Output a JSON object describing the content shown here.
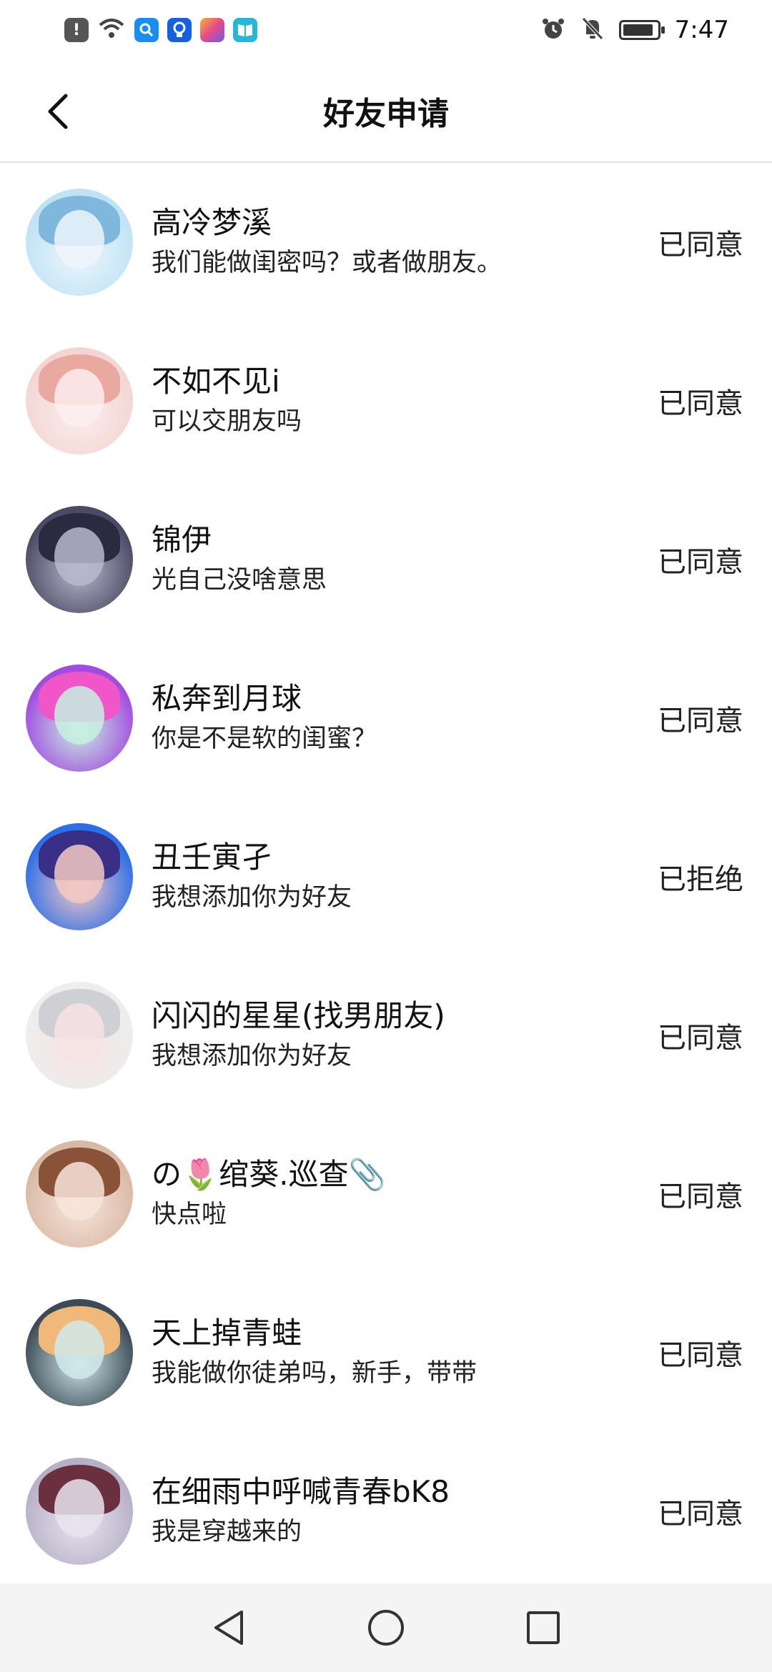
{
  "status_bar": {
    "time": "7:47",
    "battery_level": 0.9,
    "notification_icons": [
      "alert-icon",
      "wifi-icon",
      "search-app-icon",
      "bulb-app-icon",
      "colorful-app-icon",
      "book-app-icon"
    ],
    "right_icons": [
      "alarm-icon",
      "mute-icon",
      "battery-icon"
    ]
  },
  "header": {
    "title": "好友申请"
  },
  "requests": [
    {
      "name": "高冷梦溪",
      "message": "我们能做闺密吗？或者做朋友。",
      "status": "已同意",
      "avatar_colors": [
        "#bfe3f5",
        "#7fb7dd",
        "#eef6fb"
      ]
    },
    {
      "name": "不如不见i",
      "message": "可以交朋友吗",
      "status": "已同意",
      "avatar_colors": [
        "#f3d6d2",
        "#e9a9a0",
        "#fbeeee"
      ]
    },
    {
      "name": "锦伊",
      "message": "光自己没啥意思",
      "status": "已同意",
      "avatar_colors": [
        "#4b4a66",
        "#2b2a40",
        "#b9b7cc"
      ]
    },
    {
      "name": "私奔到月球",
      "message": "你是不是软的闺蜜？",
      "status": "已同意",
      "avatar_colors": [
        "#a24be0",
        "#f056c8",
        "#c7f1e0"
      ]
    },
    {
      "name": "丑壬寅孑",
      "message": "我想添加你为好友",
      "status": "已拒绝",
      "avatar_colors": [
        "#2b6ee8",
        "#3a2f86",
        "#f5c9c3"
      ]
    },
    {
      "name": "闪闪的星星(找男朋友)",
      "message": "我想添加你为好友",
      "status": "已同意",
      "avatar_colors": [
        "#eeeeee",
        "#cfcfd6",
        "#f6e3e3"
      ]
    },
    {
      "name": "の🌷绾葵.巡查📎",
      "message": "快点啦",
      "status": "已同意",
      "avatar_colors": [
        "#d9b8a4",
        "#8a5236",
        "#f7e5dc"
      ]
    },
    {
      "name": "天上掉青蛙",
      "message": "我能做你徒弟吗，新手，带带",
      "status": "已同意",
      "avatar_colors": [
        "#3c4a56",
        "#f0b97a",
        "#cfe9ea"
      ]
    },
    {
      "name": "在细雨中呼喊青春bK8",
      "message": "我是穿越来的",
      "status": "已同意",
      "avatar_colors": [
        "#b7b0c6",
        "#6a3040",
        "#e8e4ee"
      ]
    }
  ],
  "nav_bar": {
    "buttons": [
      "back-triangle-icon",
      "home-circle-icon",
      "recents-square-icon"
    ]
  }
}
